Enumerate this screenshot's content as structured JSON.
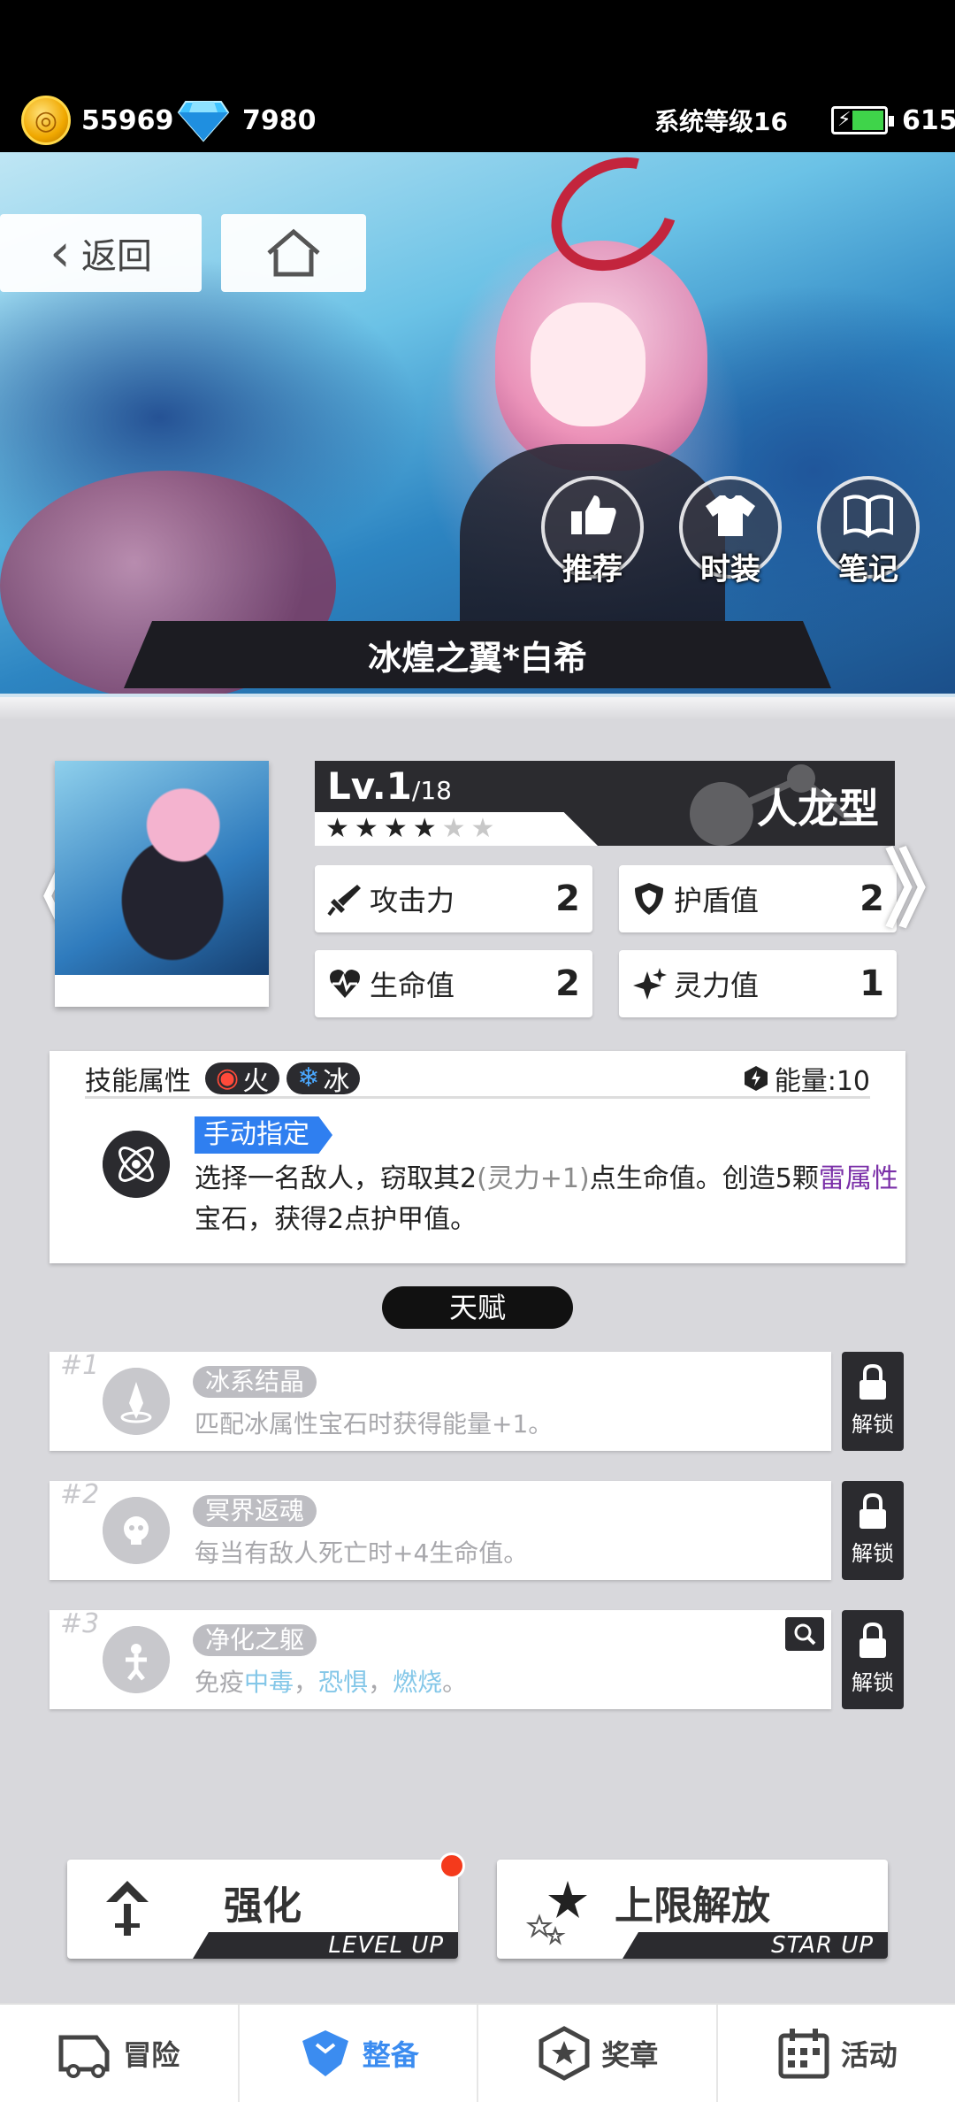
{
  "status": {
    "gold": "55969",
    "diamonds": "7980",
    "system_level": "系统等级16",
    "energy": "615"
  },
  "nav": {
    "back_label": "返回"
  },
  "banner": {
    "buttons": [
      {
        "label": "推荐"
      },
      {
        "label": "时装"
      },
      {
        "label": "笔记"
      }
    ],
    "character_name": "冰煌之翼*白希"
  },
  "character": {
    "level": "Lv.1",
    "level_max": "/18",
    "type": "人龙型",
    "stars_filled": 4,
    "stars_total": 6,
    "stats": {
      "attack": {
        "label": "攻击力",
        "value": "2"
      },
      "shield": {
        "label": "护盾值",
        "value": "2"
      },
      "hp": {
        "label": "生命值",
        "value": "2"
      },
      "spirit": {
        "label": "灵力值",
        "value": "1"
      }
    }
  },
  "skill": {
    "header": "技能属性",
    "tags": [
      {
        "label": "火"
      },
      {
        "label": "冰"
      }
    ],
    "energy": "能量:10",
    "manual": "手动指定",
    "desc_1": "选择一名敌人，窃取其2",
    "desc_2": "(灵力+1)",
    "desc_3": "点生命值。创造5颗",
    "desc_4": "雷属性",
    "desc_5": "宝石，获得2点护甲值。"
  },
  "talents": {
    "title": "天赋",
    "items": [
      {
        "num": "#1",
        "name": "冰系结晶",
        "desc": "匹配冰属性宝石时获得能量+1。",
        "lock": "解锁"
      },
      {
        "num": "#2",
        "name": "冥界返魂",
        "desc": "每当有敌人死亡时+4生命值。",
        "lock": "解锁"
      },
      {
        "num": "#3",
        "name": "净化之躯",
        "desc_pre": "免疫",
        "d1": "中毒",
        "sep1": "，",
        "d2": "恐惧",
        "sep2": "，",
        "d3": "燃烧",
        "desc_post": "。",
        "lock": "解锁"
      }
    ]
  },
  "actions": {
    "enhance": {
      "label": "强化",
      "sub": "LEVEL UP"
    },
    "limit": {
      "label": "上限解放",
      "sub": "STAR UP"
    }
  },
  "tabs": [
    {
      "label": "冒险"
    },
    {
      "label": "整备"
    },
    {
      "label": "奖章"
    },
    {
      "label": "活动"
    }
  ],
  "colors": {
    "accent": "#3b8cf0",
    "dark": "#2b2b2f",
    "fire": "#ff4a3a",
    "ice": "#4aa8ff",
    "badge": "#f43a1c"
  }
}
